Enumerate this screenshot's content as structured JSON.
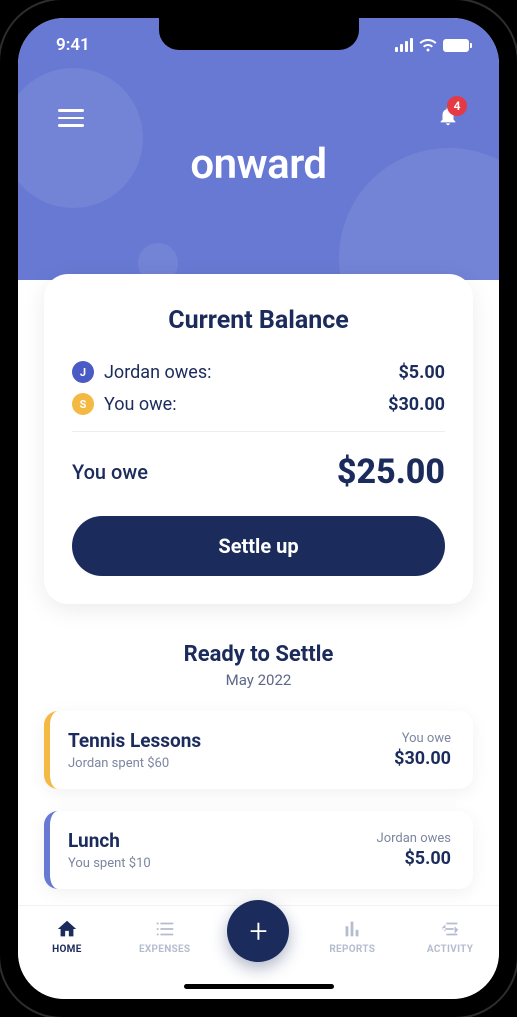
{
  "status": {
    "time": "9:41"
  },
  "header": {
    "logo": "onward",
    "notification_count": "4"
  },
  "balance": {
    "title": "Current Balance",
    "rows": [
      {
        "avatar_letter": "J",
        "label": "Jordan owes:",
        "amount": "$5.00"
      },
      {
        "avatar_letter": "S",
        "label": "You owe:",
        "amount": "$30.00"
      }
    ],
    "total_label": "You owe",
    "total_amount": "$25.00",
    "settle_button": "Settle up"
  },
  "ready": {
    "title": "Ready to Settle",
    "period": "May 2022",
    "items": [
      {
        "title": "Tennis Lessons",
        "subtitle": "Jordan spent $60",
        "owe_label": "You owe",
        "amount": "$30.00"
      },
      {
        "title": "Lunch",
        "subtitle": "You spent $10",
        "owe_label": "Jordan owes",
        "amount": "$5.00"
      }
    ]
  },
  "nav": {
    "home": "HOME",
    "expenses": "EXPENSES",
    "reports": "REPORTS",
    "activity": "ACTIVITY"
  }
}
